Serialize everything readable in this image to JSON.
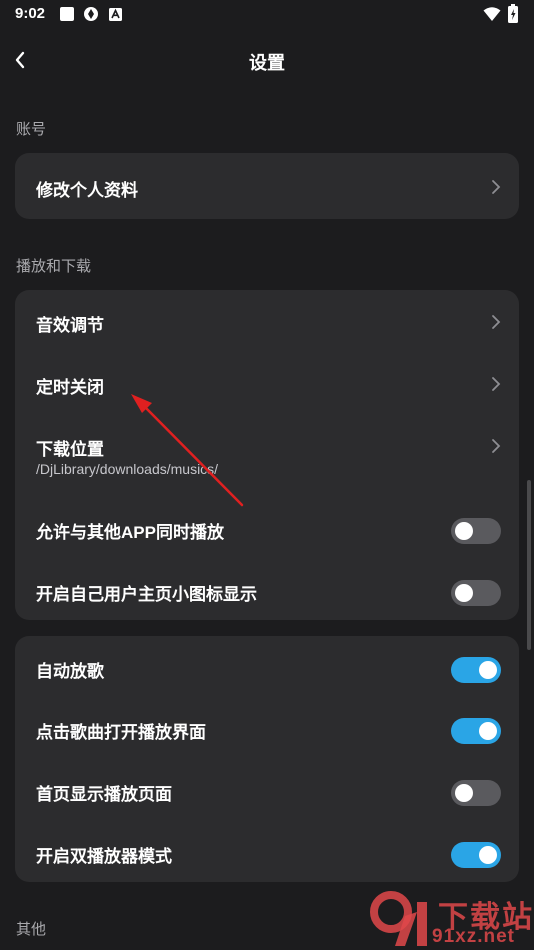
{
  "status_bar": {
    "time": "9:02"
  },
  "header": {
    "title": "设置"
  },
  "sections": {
    "account": {
      "label": "账号",
      "items": [
        "修改个人资料"
      ]
    },
    "playback": {
      "label": "播放和下载",
      "items": [
        {
          "label": "音效调节"
        },
        {
          "label": "定时关闭"
        },
        {
          "label": "下载位置",
          "sub": "/DjLibrary/downloads/musics/"
        },
        {
          "label": "允许与其他APP同时播放",
          "toggle": false
        },
        {
          "label": "开启自己用户主页小图标显示",
          "toggle": false
        }
      ]
    },
    "auto": {
      "items": [
        {
          "label": "自动放歌",
          "toggle": true
        },
        {
          "label": "点击歌曲打开播放界面",
          "toggle": true
        },
        {
          "label": "首页显示播放页面",
          "toggle": false
        },
        {
          "label": "开启双播放器模式",
          "toggle": true
        }
      ]
    },
    "other": {
      "label": "其他"
    }
  },
  "watermark": {
    "text": "下载站",
    "url": "91xz.net"
  },
  "colors": {
    "background": "#1c1c1e",
    "card": "#2c2c2e",
    "toggle_on": "#2aa5e6",
    "toggle_off": "#5a5a5e",
    "annotation_arrow": "#e02020"
  }
}
